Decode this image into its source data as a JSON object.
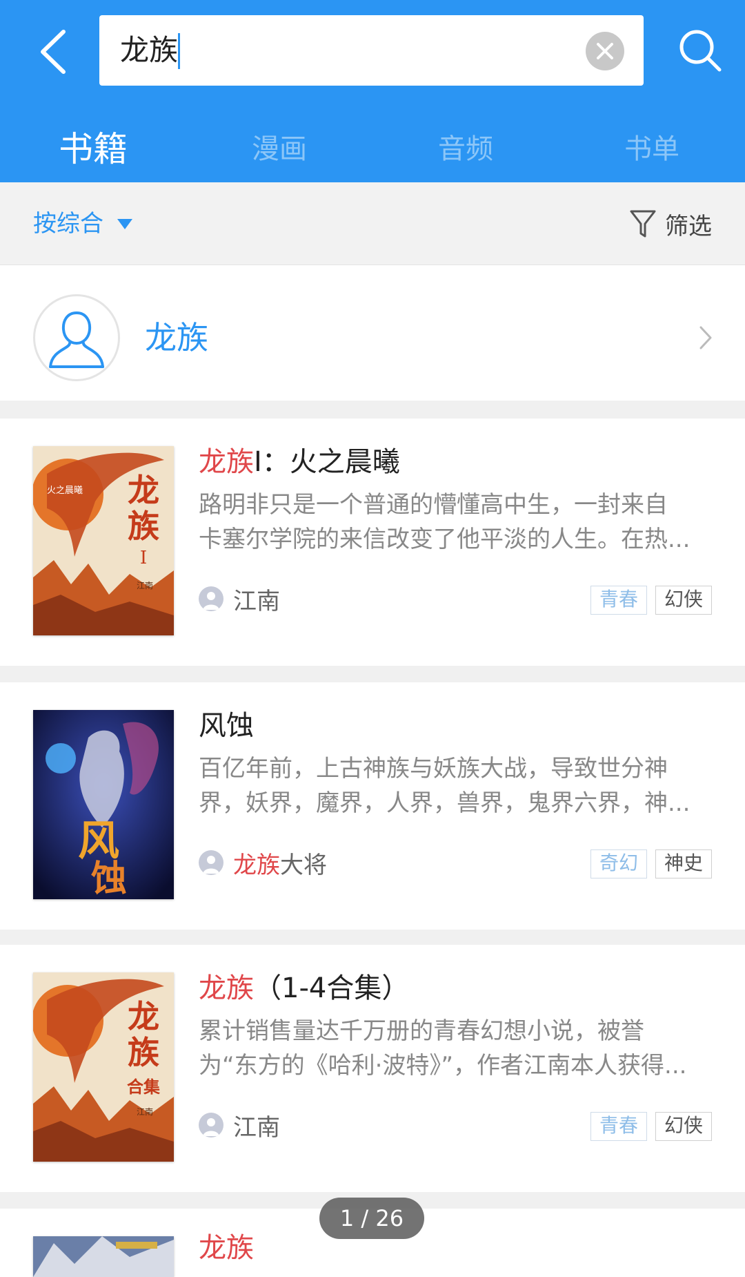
{
  "search": {
    "query": "龙族"
  },
  "tabs": [
    {
      "label": "书籍",
      "active": true
    },
    {
      "label": "漫画",
      "active": false
    },
    {
      "label": "音频",
      "active": false
    },
    {
      "label": "书单",
      "active": false
    }
  ],
  "filterbar": {
    "sort_label": "按综合",
    "filter_label": "筛选"
  },
  "author_card": {
    "name": "龙族"
  },
  "books": [
    {
      "title_hl": "龙族",
      "title_rest": "Ⅰ：火之晨曦",
      "desc_line1": "路明非只是一个普通的懵懂高中生，一封来自",
      "desc_line2": "卡塞尔学院的来信改变了他平淡的人生。在热...",
      "author_hl": "",
      "author_rest": "江南",
      "tags": [
        {
          "label": "青春",
          "style": "blue"
        },
        {
          "label": "幻侠",
          "style": "gray"
        }
      ],
      "cover_text": "龙族",
      "cover_sub": "I",
      "cover_small": "火之晨曦",
      "cover_author": "江南"
    },
    {
      "title_hl": "",
      "title_rest": "风蚀",
      "desc_line1": "百亿年前，上古神族与妖族大战，导致世分神",
      "desc_line2": "界，妖界，魔界，人界，兽界，鬼界六界，神...",
      "author_hl": "龙族",
      "author_rest": "大将",
      "tags": [
        {
          "label": "奇幻",
          "style": "blue"
        },
        {
          "label": "神史",
          "style": "gray"
        }
      ],
      "cover_text": "风蚀"
    },
    {
      "title_hl": "龙族",
      "title_rest": "（1-4合集）",
      "desc_line1": "累计销售量达千万册的青春幻想小说，被誉",
      "desc_line2": "为“东方的《哈利·波特》”，作者江南本人获得...",
      "author_hl": "",
      "author_rest": "江南",
      "tags": [
        {
          "label": "青春",
          "style": "blue"
        },
        {
          "label": "幻侠",
          "style": "gray"
        }
      ],
      "cover_text": "龙族",
      "cover_sub": "合集",
      "cover_author": "江南"
    },
    {
      "title_hl": "龙族",
      "title_rest": ""
    }
  ],
  "pager": {
    "text": "1 / 26"
  },
  "colors": {
    "brand_blue": "#2b95f3",
    "highlight_red": "#e0474a"
  }
}
